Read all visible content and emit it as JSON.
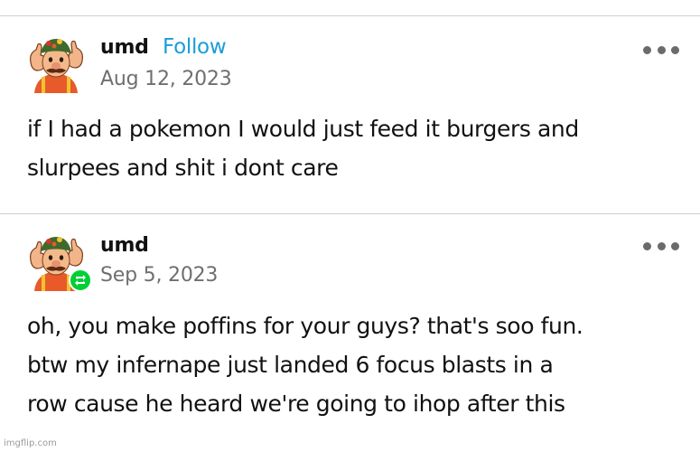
{
  "posts": [
    {
      "username": "umd",
      "follow_label": "Follow",
      "date": "Aug 12, 2023",
      "more_icon": "more-options-icon",
      "avatar_icon": "avatar-image",
      "body_lines": [
        "if I had a pokemon I would just feed it burgers and",
        "slurpees and shit i dont care"
      ]
    },
    {
      "username": "umd",
      "date": "Sep 5, 2023",
      "more_icon": "more-options-icon",
      "avatar_icon": "avatar-image",
      "badge_icon": "reblog-icon",
      "body_lines": [
        "oh, you make poffins for your guys? that's soo fun.",
        "btw my infernape just landed 6 focus blasts in a",
        "row cause he heard we're going to ihop after this"
      ]
    }
  ],
  "watermark": "imgflip.com",
  "colors": {
    "follow": "#1a9dd9",
    "reblog_badge": "#00cf35",
    "date": "#6f6f6f",
    "divider": "#cfcfcf"
  }
}
